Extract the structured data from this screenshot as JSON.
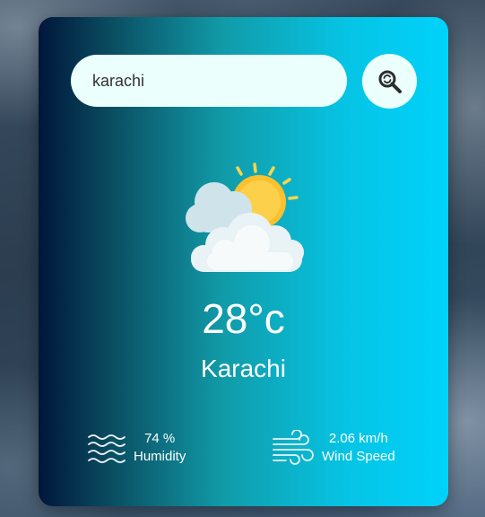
{
  "search": {
    "value": "karachi"
  },
  "weather": {
    "icon": "clouds-sun-icon",
    "temperature": "28°c",
    "city": "Karachi"
  },
  "humidity": {
    "value": "74 %",
    "label": "Humidity",
    "icon": "humidity-waves-icon"
  },
  "wind": {
    "value": "2.06 km/h",
    "label": "Wind Speed",
    "icon": "wind-icon"
  },
  "colors": {
    "card_gradient_start": "#01163a",
    "card_gradient_end": "#00d2fb",
    "input_background": "#ebfffc",
    "text": "#ffffff"
  }
}
